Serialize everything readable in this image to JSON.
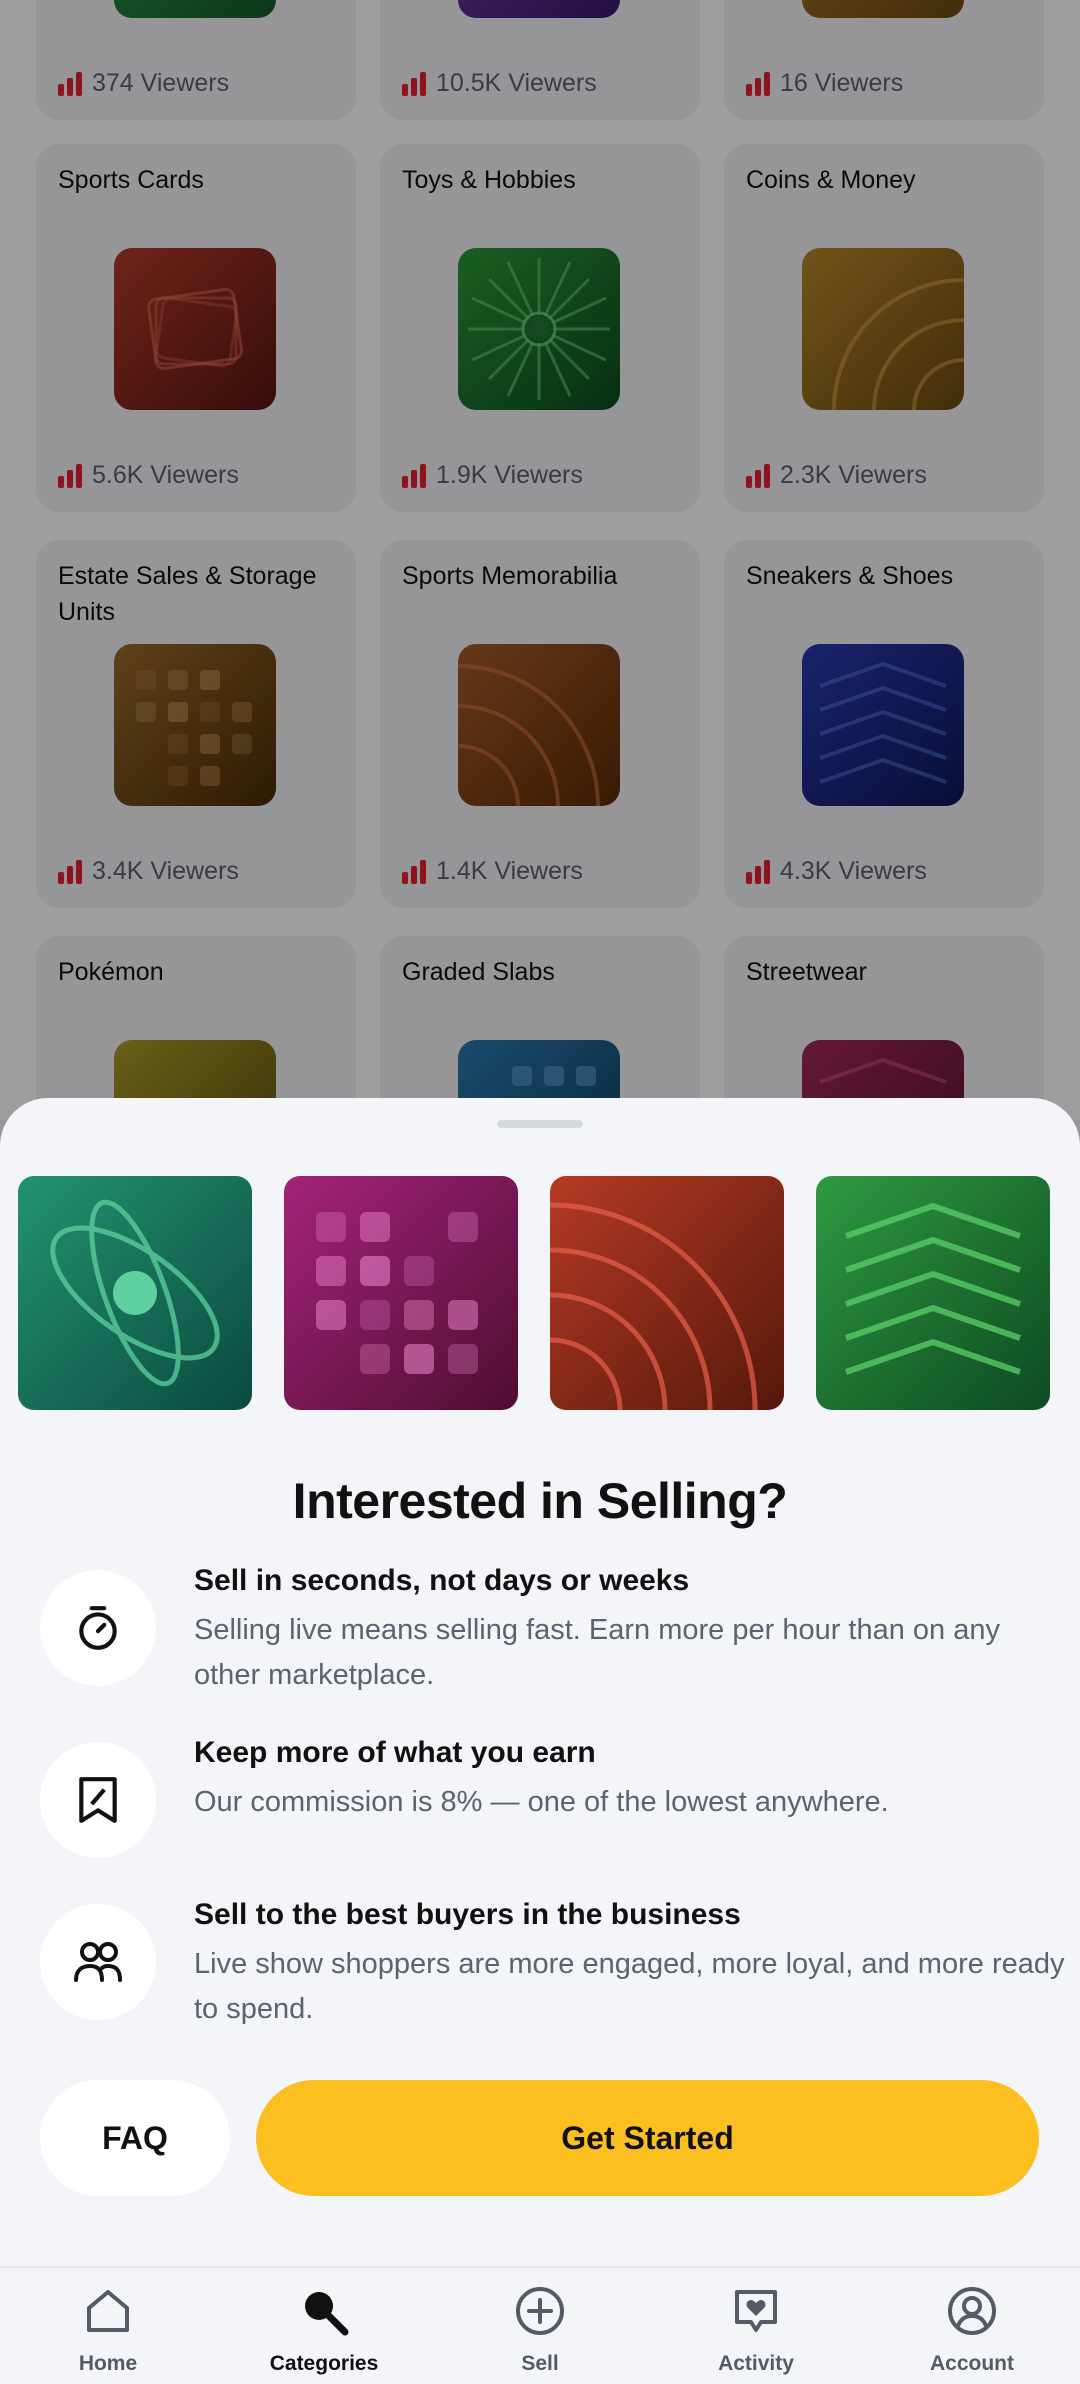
{
  "categories": [
    {
      "name": "",
      "viewers": "374 Viewers",
      "icon": "partial-tile-icon",
      "color": "#1f7a3a"
    },
    {
      "name": "",
      "viewers": "10.5K Viewers",
      "icon": "partial-tile-icon",
      "color": "#5a2a8a"
    },
    {
      "name": "",
      "viewers": "16 Viewers",
      "icon": "partial-tile-icon",
      "color": "#8a5a1a"
    },
    {
      "name": "Sports Cards",
      "viewers": "5.6K Viewers",
      "icon": "cards-icon",
      "color": "#8a2a20"
    },
    {
      "name": "Toys & Hobbies",
      "viewers": "1.9K Viewers",
      "icon": "sunburst-icon",
      "color": "#1f7a2a"
    },
    {
      "name": "Coins & Money",
      "viewers": "2.3K Viewers",
      "icon": "arcs-icon",
      "color": "#9a6a10"
    },
    {
      "name": "Estate Sales & Storage Units",
      "viewers": "3.4K Viewers",
      "icon": "dots-grid-icon",
      "color": "#7a4a10"
    },
    {
      "name": "Sports Memorabilia",
      "viewers": "1.4K Viewers",
      "icon": "arcs-icon",
      "color": "#8a3a10"
    },
    {
      "name": "Sneakers & Shoes",
      "viewers": "4.3K Viewers",
      "icon": "chevrons-icon",
      "color": "#1a2a8a"
    },
    {
      "name": "Pokémon",
      "viewers": "",
      "icon": "sunburst-icon",
      "color": "#7a6a10"
    },
    {
      "name": "Graded Slabs",
      "viewers": "",
      "icon": "dots-grid-icon",
      "color": "#1a5a8a"
    },
    {
      "name": "Streetwear",
      "viewers": "",
      "icon": "chevrons-icon",
      "color": "#8a1a4a"
    }
  ],
  "sheet": {
    "title": "Interested in Selling?",
    "tiles": [
      {
        "icon": "orbit-icon",
        "color": "#1e8a6a"
      },
      {
        "icon": "dots-grid-icon",
        "color": "#a0256f"
      },
      {
        "icon": "arcs-icon",
        "color": "#b03a25"
      },
      {
        "icon": "chevrons-icon",
        "color": "#2e8a3a"
      }
    ],
    "features": [
      {
        "icon": "stopwatch-icon",
        "title": "Sell in seconds, not days or weeks",
        "body": "Selling live means selling fast. Earn more per hour than on any other marketplace."
      },
      {
        "icon": "receipt-icon",
        "title": "Keep more of what you earn",
        "body": "Our commission is 8% — one of the lowest anywhere."
      },
      {
        "icon": "people-icon",
        "title": "Sell to the best buyers in the business",
        "body": "Live show shoppers are more engaged, more loyal, and more ready to spend."
      }
    ],
    "faq_label": "FAQ",
    "cta_label": "Get Started",
    "cta_color": "#fbc01f"
  },
  "nav": {
    "items": [
      {
        "label": "Home",
        "icon": "home-icon"
      },
      {
        "label": "Categories",
        "icon": "search-icon",
        "active": true
      },
      {
        "label": "Sell",
        "icon": "plus-circle-icon"
      },
      {
        "label": "Activity",
        "icon": "heart-chat-icon"
      },
      {
        "label": "Account",
        "icon": "user-circle-icon"
      }
    ]
  }
}
